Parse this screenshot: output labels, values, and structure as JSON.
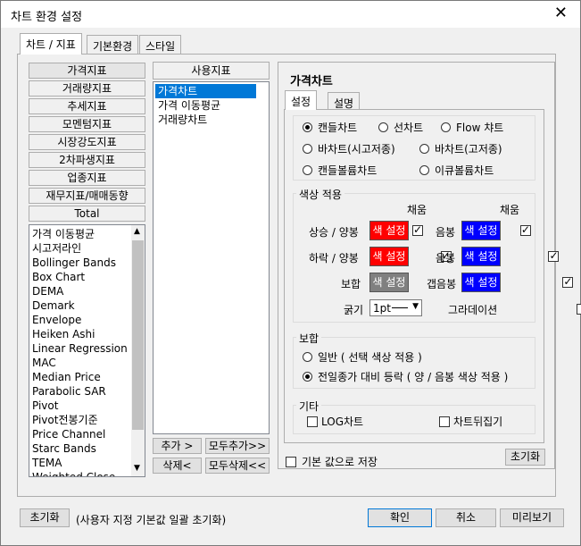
{
  "window": {
    "title": "차트 환경 설정",
    "close_glyph": "✕"
  },
  "tabs": [
    "차트 / 지표",
    "기본환경",
    "스타일"
  ],
  "categories": [
    "가격지표",
    "거래량지표",
    "추세지표",
    "모멘텀지표",
    "시장강도지표",
    "2차파생지표",
    "업종지표",
    "재무지표/매매동향",
    "Total"
  ],
  "indicator_list": [
    "가격 이동평균",
    "시고저라인",
    "Bollinger Bands",
    "Box Chart",
    "DEMA",
    "Demark",
    "Envelope",
    "Heiken Ashi",
    "Linear Regression ...",
    "MAC",
    "Median Price",
    "Parabolic SAR",
    "Pivot",
    "Pivot전봉기준",
    "Price Channel",
    "Starc Bands",
    "TEMA",
    "Weighted Close"
  ],
  "used": {
    "header": "사용지표",
    "items": [
      "가격차트",
      "가격 이동평균",
      "거래량차트"
    ]
  },
  "buttons": {
    "add": "추가 >",
    "add_all": "모두추가>>",
    "delete": "삭제<",
    "delete_all": "모두삭제<<"
  },
  "detail": {
    "title": "가격차트",
    "subtabs": [
      "설정",
      "설명"
    ],
    "chart_types": [
      "캔들차트",
      "선차트",
      "Flow 챠트",
      "바차트(시고저종)",
      "바차트(고저종)",
      "캔들볼륨차트",
      "이큐볼륨차트"
    ],
    "color_group": {
      "title": "색상 적용",
      "fill_label": "채움",
      "rows": [
        {
          "label": "상승 / 양봉",
          "btn": "색 설정",
          "color": "#ff0000"
        },
        {
          "label": "음봉",
          "btn": "색 설정",
          "color": "#0000ff"
        },
        {
          "label": "하락 / 양봉",
          "btn": "색 설정",
          "color": "#ff0000"
        },
        {
          "label": "음봉",
          "btn": "색 설정",
          "color": "#0000ff"
        },
        {
          "label": "보합",
          "btn": "색 설정",
          "color": "#808080"
        },
        {
          "label": "갭음봉",
          "btn": "색 설정",
          "color": "#0000ff"
        }
      ],
      "thickness_label": "굵기",
      "thickness_value": "1pt",
      "gradation_label": "그라데이션"
    },
    "bohap_group": {
      "title": "보합",
      "options": [
        "일반 ( 선택 색상 적용 )",
        "전일종가 대비 등락 ( 양 / 음봉 색상 적용 )"
      ]
    },
    "etc_group": {
      "title": "기타",
      "options": [
        "LOG차트",
        "차트뒤집기"
      ]
    },
    "save_default": "기본 값으로 저장",
    "reset": "초기화"
  },
  "footer": {
    "reset": "초기화",
    "reset_desc": "(사용자 지정 기본값 일괄 초기화)",
    "ok": "확인",
    "cancel": "취소",
    "preview": "미리보기"
  }
}
